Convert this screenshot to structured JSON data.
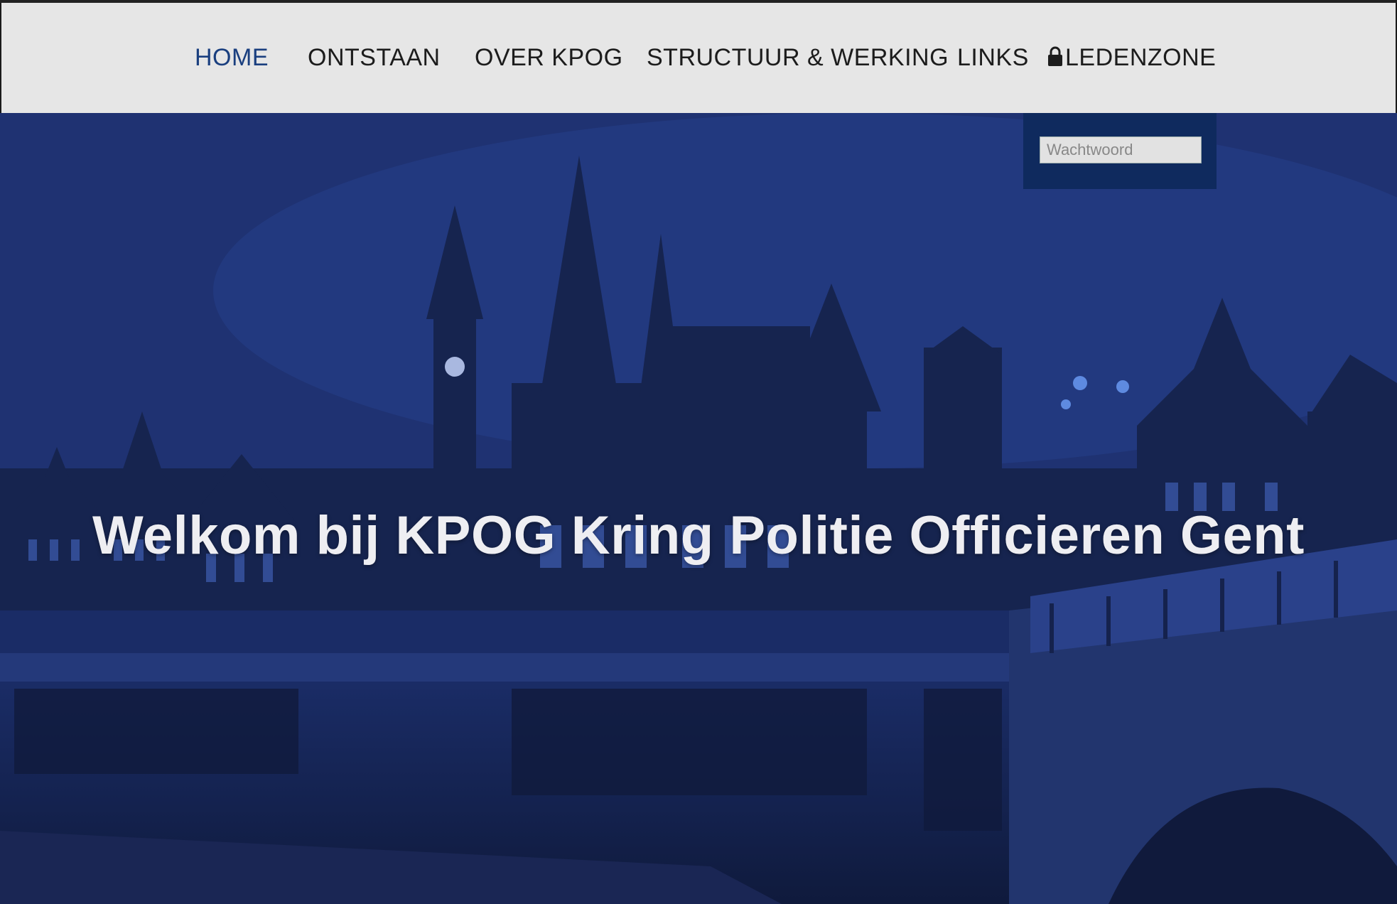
{
  "nav": {
    "items": [
      {
        "label": "HOME",
        "active": true
      },
      {
        "label": "ONTSTAAN",
        "active": false
      },
      {
        "label": "OVER KPOG",
        "active": false
      },
      {
        "label": "STRUCTUUR & WERKING",
        "active": false
      },
      {
        "label": "LINKS",
        "active": false
      },
      {
        "label": "LEDENZONE",
        "active": false,
        "icon": "lock-icon"
      }
    ]
  },
  "login": {
    "password_placeholder": "Wachtwoord"
  },
  "hero": {
    "title": "Welkom bij KPOG Kring Politie Officieren Gent"
  },
  "colors": {
    "nav_background": "#e6e6e6",
    "nav_active": "#1a3f7f",
    "login_panel": "#0f2a5e",
    "hero_tint": "#203473"
  }
}
